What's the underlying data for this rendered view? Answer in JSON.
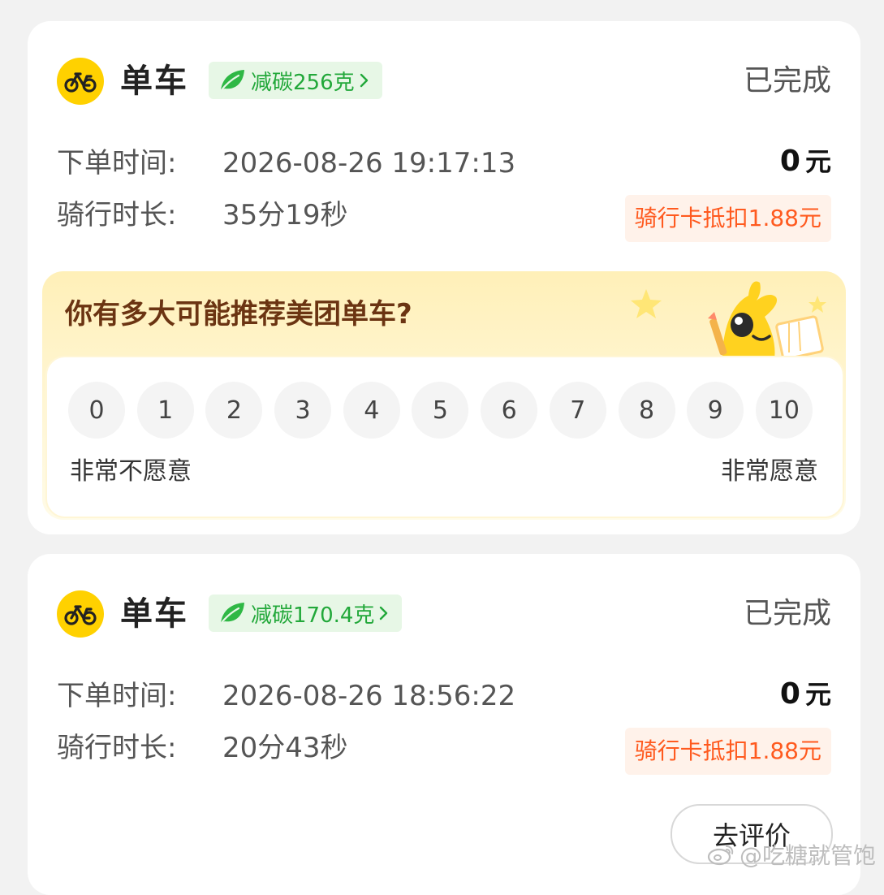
{
  "orders": [
    {
      "title": "单车",
      "carbon_badge": "减碳256克",
      "status": "已完成",
      "order_time_label": "下单时间:",
      "order_time": "2026-08-26 19:17:13",
      "duration_label": "骑行时长:",
      "duration": "35分19秒",
      "price_amount": "0",
      "price_unit": "元",
      "discount_note": "骑行卡抵扣1.88元"
    },
    {
      "title": "单车",
      "carbon_badge": "减碳170.4克",
      "status": "已完成",
      "order_time_label": "下单时间:",
      "order_time": "2026-08-26 18:56:22",
      "duration_label": "骑行时长:",
      "duration": "20分43秒",
      "price_amount": "0",
      "price_unit": "元",
      "discount_note": "骑行卡抵扣1.88元",
      "review_button": "去评价"
    }
  ],
  "survey": {
    "question": "你有多大可能推荐美团单车?",
    "scores": [
      "0",
      "1",
      "2",
      "3",
      "4",
      "5",
      "6",
      "7",
      "8",
      "9",
      "10"
    ],
    "low_label": "非常不愿意",
    "high_label": "非常愿意"
  },
  "watermark": "@吃糖就管饱",
  "icons": {
    "bike": "bike-icon",
    "leaf": "leaf-icon",
    "chevron": "chevron-right-icon",
    "mascot": "mascot-illustration",
    "weibo": "weibo-icon"
  },
  "colors": {
    "brand_yellow": "#ffd100",
    "carbon_green": "#22a83a",
    "carbon_bg": "#e7f7e6",
    "discount_orange": "#ff5a1f",
    "survey_question": "#6b3412"
  }
}
